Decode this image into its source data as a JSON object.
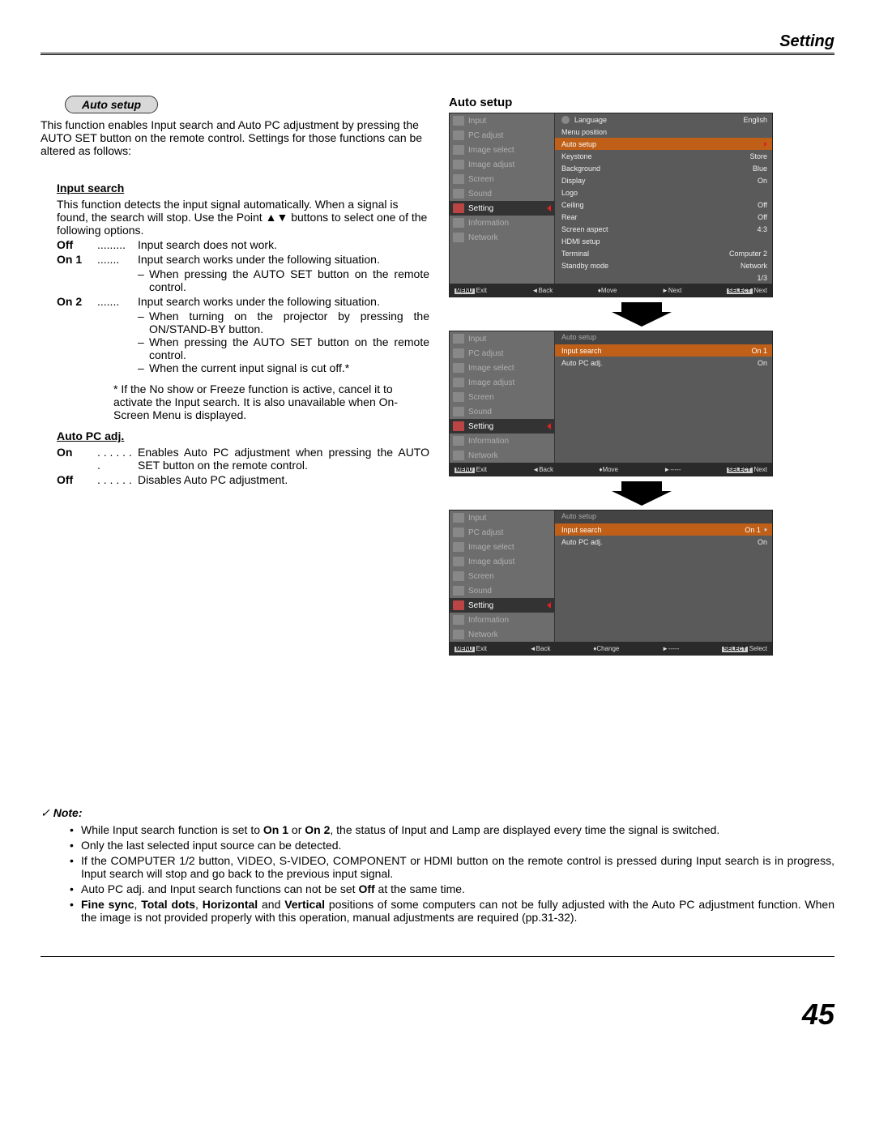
{
  "header": {
    "title": "Setting"
  },
  "left": {
    "badge_title": "Auto setup",
    "intro": "This function enables Input search and Auto PC adjustment by pressing the AUTO SET button on the remote control. Settings for those functions can be altered as follows:",
    "input_search": {
      "title": "Input search",
      "desc": "This function detects the input signal automatically. When a signal is found, the search will stop. Use the Point ▲▼ buttons to select one of the following options.",
      "opts": [
        {
          "key": "Off",
          "dots": ".........",
          "val": "Input search does not work."
        },
        {
          "key": "On 1",
          "dots": ".......",
          "val": "Input search works under the following situation."
        }
      ],
      "on1_sub": [
        "When pressing the AUTO SET button on the remote control."
      ],
      "opt_on2": {
        "key": "On 2",
        "dots": ".......",
        "val": "Input search works under the following situation."
      },
      "on2_sub": [
        "When turning on the projector by pressing the ON/STAND-BY button.",
        "When pressing the AUTO SET button on the remote control.",
        "When the current input signal is cut off.*"
      ],
      "footnote": "* If the No show or Freeze function is active, cancel it to activate the Input search. It is also unavailable when On-Screen Menu is displayed."
    },
    "auto_pc": {
      "title": "Auto PC adj.",
      "opts": [
        {
          "key": "On",
          "dots": ". . . . . . .",
          "val": "Enables Auto PC adjustment when pressing the AUTO SET button on the remote control."
        },
        {
          "key": "Off",
          "dots": ". . . . . .",
          "val": "Disables Auto PC adjustment."
        }
      ]
    }
  },
  "right": {
    "heading": "Auto setup",
    "menu_items": [
      {
        "label": "Input"
      },
      {
        "label": "PC adjust"
      },
      {
        "label": "Image select"
      },
      {
        "label": "Image adjust"
      },
      {
        "label": "Screen"
      },
      {
        "label": "Sound"
      },
      {
        "label": "Setting",
        "active": true
      },
      {
        "label": "Information"
      },
      {
        "label": "Network"
      }
    ],
    "osd1_details": [
      {
        "label": "Language",
        "val": "English",
        "icon": true
      },
      {
        "label": "Menu position",
        "val": ""
      },
      {
        "label": "Auto setup",
        "val": "",
        "hl": true,
        "arrow": true
      },
      {
        "label": "Keystone",
        "val": "Store"
      },
      {
        "label": "Background",
        "val": "Blue"
      },
      {
        "label": "Display",
        "val": "On"
      },
      {
        "label": "Logo",
        "val": ""
      },
      {
        "label": "Ceiling",
        "val": "Off"
      },
      {
        "label": "Rear",
        "val": "Off"
      },
      {
        "label": "Screen aspect",
        "val": "4:3"
      },
      {
        "label": "HDMI setup",
        "val": ""
      },
      {
        "label": "Terminal",
        "val": "Computer 2"
      },
      {
        "label": "Standby mode",
        "val": "Network"
      },
      {
        "label": "",
        "val": "1/3"
      }
    ],
    "osd1_footer": {
      "exit": "Exit",
      "back": "Back",
      "move": "Move",
      "next": "Next",
      "select": "Next",
      "exit_badge": "MENU",
      "sel_badge": "SELECT"
    },
    "osd2_header": "Auto setup",
    "osd2_details": [
      {
        "label": "Input search",
        "val": "On 1",
        "hl": true
      },
      {
        "label": "Auto PC adj.",
        "val": "On"
      }
    ],
    "osd2_footer": {
      "exit": "Exit",
      "back": "Back",
      "move": "Move",
      "next": "-----",
      "select": "Next",
      "exit_badge": "MENU",
      "sel_badge": "SELECT"
    },
    "osd3_header": "Auto setup",
    "osd3_details": [
      {
        "label": "Input search",
        "val": "On 1",
        "hl": true,
        "caret": true
      },
      {
        "label": "Auto PC adj.",
        "val": "On"
      }
    ],
    "osd3_footer": {
      "exit": "Exit",
      "back": "Back",
      "move": "Change",
      "next": "-----",
      "select": "Select",
      "exit_badge": "MENU",
      "sel_badge": "SELECT"
    }
  },
  "notes": {
    "head": "Note:",
    "items": [
      {
        "pre": "While Input search function is set to ",
        "b1": "On 1",
        "mid": " or ",
        "b2": "On 2",
        "post": ", the status of Input and Lamp are displayed every time the signal is switched."
      },
      {
        "plain": "Only the last selected input source can be detected."
      },
      {
        "plain": "If the COMPUTER 1/2 button, VIDEO, S-VIDEO, COMPONENT or HDMI button on the remote control is pressed during Input search is in progress, Input search will stop and go back to the previous input signal."
      },
      {
        "pre": "Auto PC adj. and Input search functions can not be set ",
        "b1": "Off",
        "post": " at the same time."
      },
      {
        "b1": "Fine sync",
        "c1": ", ",
        "b2": "Total dots",
        "c2": ", ",
        "b3": "Horizontal",
        "c3": " and ",
        "b4": "Vertical",
        "post": " positions of some computers can not be fully adjusted with the Auto PC adjustment function. When the image is not provided properly with this operation, manual adjustments are required (pp.31-32)."
      }
    ]
  },
  "page_number": "45"
}
